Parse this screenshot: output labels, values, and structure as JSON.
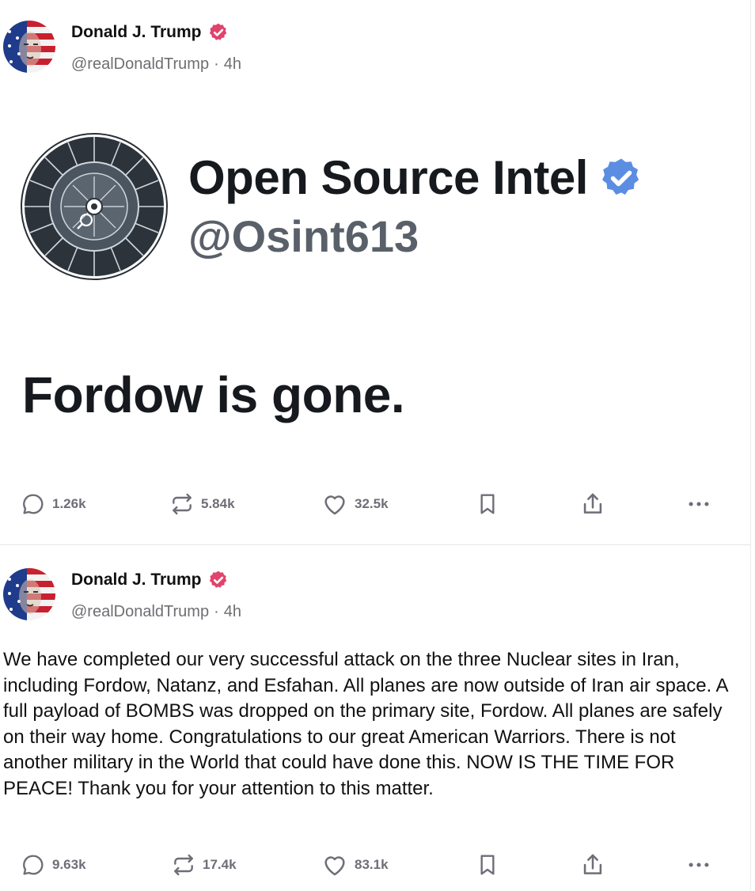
{
  "colors": {
    "verified_badge": "#e0436b",
    "osint_badge": "#5b8de3",
    "action_gray": "#6e6e78",
    "divider": "#e5e5ea"
  },
  "posts": [
    {
      "author": {
        "name": "Donald J. Trump",
        "handle": "@realDonaldTrump",
        "separator": "·",
        "time": "4h"
      },
      "embed": {
        "account_name": "Open Source Intel",
        "account_handle": "@Osint613",
        "text": "Fordow is gone."
      },
      "stats": {
        "replies": "1.26k",
        "reposts": "5.84k",
        "likes": "32.5k"
      }
    },
    {
      "author": {
        "name": "Donald J. Trump",
        "handle": "@realDonaldTrump",
        "separator": "·",
        "time": "4h"
      },
      "text": "We have completed our very successful attack on the three Nuclear sites in Iran, including Fordow, Natanz, and Esfahan. All planes are now outside of Iran air space. A full payload of BOMBS was dropped on the primary site, Fordow. All planes are safely on their way home. Congratulations to our great American Warriors. There is not another military in the World that could have done this. NOW IS THE TIME FOR PEACE! Thank you for your attention to this matter.",
      "stats": {
        "replies": "9.63k",
        "reposts": "17.4k",
        "likes": "83.1k"
      }
    }
  ],
  "icons": {
    "reply": "speech-bubble-icon",
    "repost": "repost-arrows-icon",
    "like": "heart-icon",
    "bookmark": "bookmark-icon",
    "share": "share-icon",
    "more": "more-dots-icon",
    "verified": "verified-badge-icon"
  }
}
